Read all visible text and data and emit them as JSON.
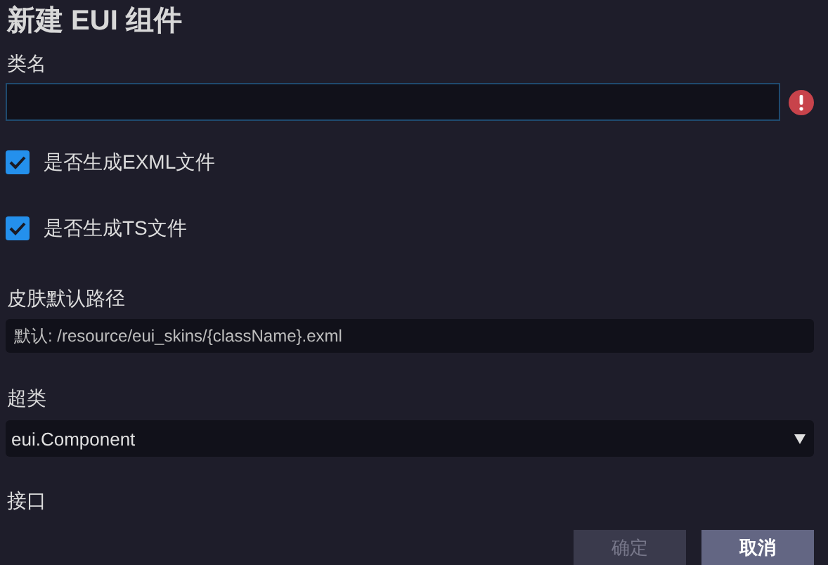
{
  "title": "新建 EUI 组件",
  "class_name": {
    "label": "类名",
    "error": true
  },
  "options": [
    {
      "label": "是否生成EXML文件",
      "checked": true
    },
    {
      "label": "是否生成TS文件",
      "checked": true
    }
  ],
  "skin_path": {
    "label": "皮肤默认路径",
    "placeholder": "默认: /resource/eui_skins/{className}.exml"
  },
  "superclass": {
    "label": "超类",
    "value": "eui.Component"
  },
  "interface": {
    "label": "接口"
  },
  "buttons": [
    {
      "label": "确定",
      "disabled": true
    },
    {
      "label": "取消",
      "disabled": false
    }
  ]
}
